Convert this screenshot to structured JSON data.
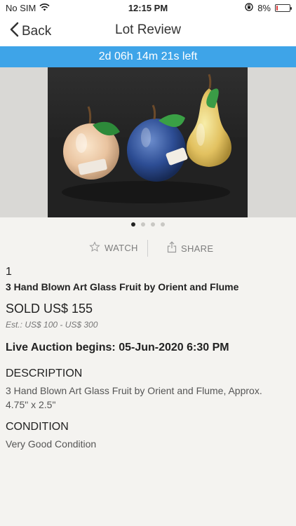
{
  "status": {
    "carrier": "No SIM",
    "time": "12:15 PM",
    "battery": "8%",
    "battery_level": 0.08,
    "icons": [
      "wifi-icon",
      "orientation-lock-icon",
      "battery-icon"
    ]
  },
  "nav": {
    "back_label": "Back",
    "title": "Lot Review"
  },
  "timer": "2d 06h 14m 21s left",
  "gallery": {
    "page_count": 4,
    "current_page": 1
  },
  "actions": {
    "watch": "WATCH",
    "share": "SHARE"
  },
  "lot": {
    "number": "1",
    "title": "3 Hand Blown Art Glass Fruit by Orient and Flume",
    "sold": "SOLD US$ 155",
    "estimate": "Est.: US$ 100 - US$ 300",
    "live_auction": "Live Auction begins: 05-Jun-2020 6:30 PM",
    "description_heading": "DESCRIPTION",
    "description": "3 Hand Blown Art Glass Fruit by Orient and Flume, Approx. 4.75\" x 2.5\"",
    "condition_heading": "CONDITION",
    "condition": "Very Good Condition"
  },
  "colors": {
    "accent": "#3ea4e8",
    "background": "#f4f3f0",
    "battery_low": "#e23b3b"
  }
}
